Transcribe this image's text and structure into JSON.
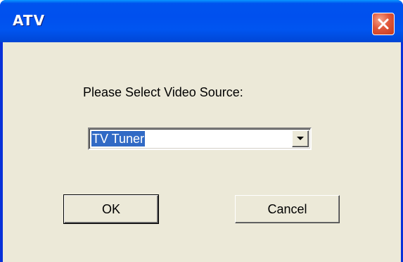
{
  "window": {
    "title": "ATV",
    "close_icon": "close-icon",
    "accent_color": "#0054e3",
    "close_color": "#e0573a",
    "face_color": "#ece9d8"
  },
  "dialog": {
    "prompt": "Please Select Video Source:",
    "source_select": {
      "selected": "TV Tuner",
      "dropdown_icon": "chevron-down-icon",
      "highlight_color": "#316ac5"
    },
    "buttons": {
      "ok_label": "OK",
      "cancel_label": "Cancel"
    }
  }
}
